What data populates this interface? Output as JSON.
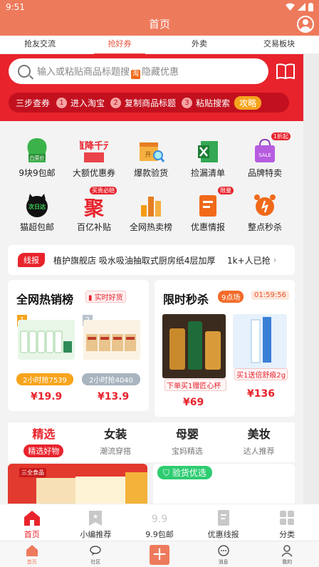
{
  "status": {
    "time": "9:51"
  },
  "header": {
    "title": "首页"
  },
  "tabs": [
    {
      "label": "抢友交流"
    },
    {
      "label": "抢好券"
    },
    {
      "label": "外卖"
    },
    {
      "label": "交易板块"
    }
  ],
  "search": {
    "placeholder_pre": "输入或粘贴商品标题搜",
    "badge": "淘",
    "placeholder_post": "隐藏优惠"
  },
  "steps": {
    "title": "三步查券",
    "items": [
      {
        "n": "1",
        "label": "进入淘宝"
      },
      {
        "n": "2",
        "label": "复制商品标题"
      },
      {
        "n": "3",
        "label": "粘贴搜索"
      }
    ],
    "guide": "攻略"
  },
  "grid": [
    {
      "label": "9块9包邮",
      "icon": "green-house-icon",
      "badge_text": "白菜价"
    },
    {
      "label": "大额优惠券",
      "icon": "big-coupon-icon",
      "badge_text": "直降千元"
    },
    {
      "label": "爆款验货",
      "icon": "inspect-box-icon",
      "badge_text": "开"
    },
    {
      "label": "捡漏清单",
      "icon": "spreadsheet-icon"
    },
    {
      "label": "品牌特卖",
      "icon": "shopping-bag-icon",
      "badge": "1折起",
      "badge_text": "SALE"
    },
    {
      "label": "猫超包邮",
      "icon": "cat-market-icon",
      "badge_text": "次日达"
    },
    {
      "label": "百亿补贴",
      "icon": "subsidy-icon",
      "badge": "买贵必赔",
      "badge_text": "聚"
    },
    {
      "label": "全网热卖榜",
      "icon": "bar-rank-icon"
    },
    {
      "label": "优惠情报",
      "icon": "info-card-icon",
      "badge": "限量"
    },
    {
      "label": "整点秒杀",
      "icon": "alarm-clock-icon"
    }
  ],
  "ticker": {
    "tag": "线报",
    "text": "植护旗舰店 吸水吸油抽取式厨房纸4层加厚",
    "count": "1k+人已抢"
  },
  "hot": {
    "title": "全网热销榜",
    "chip": "实时好货",
    "items": [
      {
        "rank": "1",
        "qty": "2小时抢7539",
        "price": "¥19.9"
      },
      {
        "rank": "2",
        "qty": "2小时抢4040",
        "price": "¥13.9"
      }
    ]
  },
  "flash": {
    "title": "限时秒杀",
    "session": "9点场",
    "countdown": "01:59:56",
    "items": [
      {
        "promo": "下单买1赠匠心杯",
        "price": "¥69"
      },
      {
        "promo": "买1送倍舒痕2g",
        "price": "¥136"
      }
    ]
  },
  "categories": [
    {
      "name": "精选",
      "sub": "精选好物"
    },
    {
      "name": "女装",
      "sub": "潮流穿搭"
    },
    {
      "name": "母婴",
      "sub": "宝妈精选"
    },
    {
      "name": "美妆",
      "sub": "达人推荐"
    }
  ],
  "banner": {
    "left_tag": "三全食品",
    "right_tag": "验货优选"
  },
  "nav_primary": [
    {
      "label": "首页",
      "icon": "home-icon"
    },
    {
      "label": "小编推荐",
      "icon": "editor-badge-icon"
    },
    {
      "label": "9.9包邮",
      "icon": "nine-nine-icon",
      "glyph": "9.9"
    },
    {
      "label": "优惠线报",
      "icon": "coupon-note-icon"
    },
    {
      "label": "分类",
      "icon": "category-grid-icon"
    }
  ],
  "nav_secondary": [
    {
      "label": "首页",
      "icon": "home-icon"
    },
    {
      "label": "社区",
      "icon": "community-icon"
    },
    {
      "label": "",
      "icon": "plus-icon",
      "glyph": "+"
    },
    {
      "label": "消息",
      "icon": "message-icon"
    },
    {
      "label": "我的",
      "icon": "profile-icon"
    }
  ],
  "colors": {
    "brand": "#ee7a5c",
    "red": "#e8232c",
    "orange": "#f7a41d",
    "green": "#2ecc71"
  }
}
